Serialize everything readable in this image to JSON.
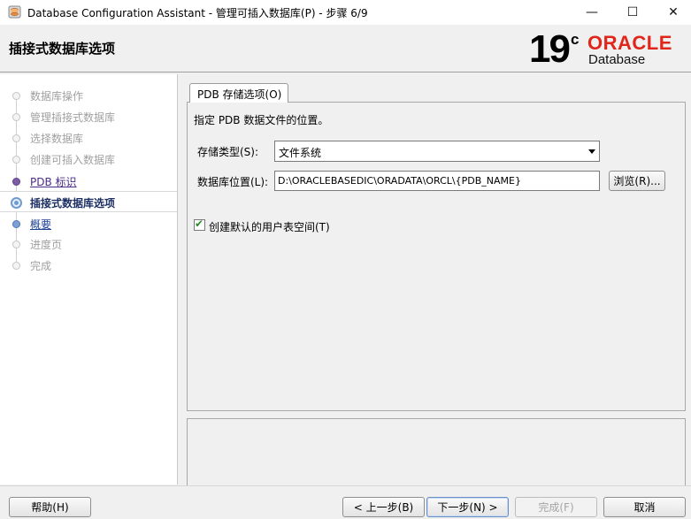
{
  "window": {
    "title": "Database Configuration Assistant - 管理可插入数据库(P) - 步骤 6/9",
    "minimize": "—",
    "maximize": "☐",
    "close": "✕"
  },
  "header": {
    "title": "插接式数据库选项",
    "logo_version": "19",
    "logo_superscript": "c",
    "logo_brand": "ORACLE",
    "logo_product": "Database",
    "brand_color": "#e0261b"
  },
  "nav": {
    "items": [
      {
        "label": "数据库操作",
        "state": "disabled"
      },
      {
        "label": "管理插接式数据库",
        "state": "disabled"
      },
      {
        "label": "选择数据库",
        "state": "disabled"
      },
      {
        "label": "创建可插入数据库",
        "state": "disabled"
      },
      {
        "label": "PDB 标识",
        "state": "done"
      },
      {
        "label": "插接式数据库选项",
        "state": "current"
      },
      {
        "label": "概要",
        "state": "next"
      },
      {
        "label": "进度页",
        "state": "disabled"
      },
      {
        "label": "完成",
        "state": "disabled"
      }
    ]
  },
  "tab": {
    "label": "PDB 存储选项(O)"
  },
  "form": {
    "description": "指定 PDB 数据文件的位置。",
    "storage_type_label": "存储类型(S):",
    "storage_type_value": "文件系统",
    "location_label": "数据库位置(L):",
    "location_value": "D:\\ORACLEBASEDIC\\ORADATA\\ORCL\\{PDB_NAME}",
    "browse_button": "浏览(R)...",
    "create_tablespace_label": "创建默认的用户表空间(T)",
    "create_tablespace_checked": true
  },
  "footer": {
    "help": "帮助(H)",
    "back": "< 上一步(B)",
    "next": "下一步(N) >",
    "finish": "完成(F)",
    "cancel": "取消"
  }
}
